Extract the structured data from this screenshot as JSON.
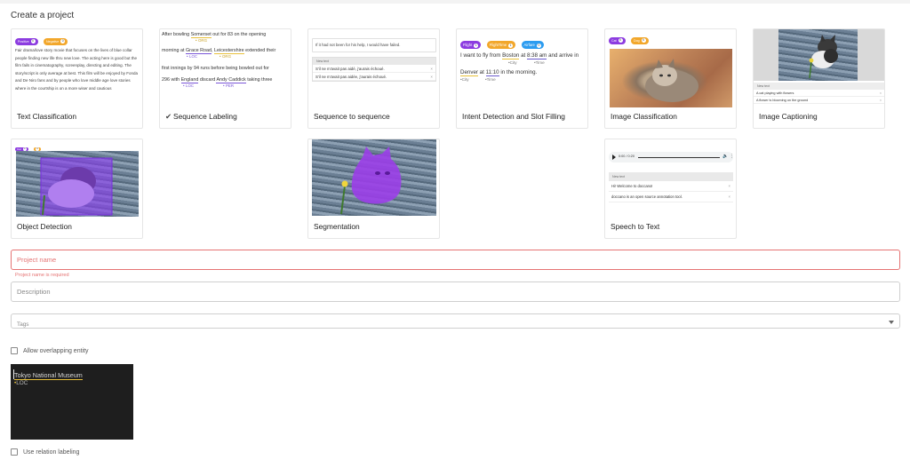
{
  "page": {
    "heading": "Create a project"
  },
  "cards": {
    "text_classification": {
      "label": "Text Classification",
      "chips": [
        {
          "text": "Positive",
          "count": "0",
          "color": "purple"
        },
        {
          "text": "Negative",
          "count": "0",
          "color": "orange"
        }
      ],
      "body": "Fair drama/love story movie that focuses on the lives of blue collar people finding new life thru new love. The acting here is good but the film fails in cinematography, screenplay, directing and editing. The story/script is only average at best. This film will be enjoyed by Fonda and De Niro fans and by people who love middle age love stories where in the courtship is on a more wiser and cautious"
    },
    "sequence_labeling": {
      "label": "Sequence Labeling",
      "check": "✔",
      "line1a": "After bowling ",
      "line1b": "Somerset",
      "line1c": " out for 83 on the opening",
      "tag_org1": "ORG",
      "line2a": "morning at ",
      "line2b": "Grace Road",
      "line2c": ", ",
      "line2d": "Leicestershire",
      "line2e": " extended their",
      "tag_loc1": "LOC",
      "tag_org2": "ORG",
      "line3": "first innings by 94 runs before being bowled out for",
      "line4a": "296 with ",
      "line4b": "England",
      "line4c": " discard ",
      "line4d": "Andy Caddick",
      "line4e": " taking three",
      "tag_loc2": "LOC",
      "tag_per": "PER"
    },
    "sequence_to_sequence": {
      "label": "Sequence to sequence",
      "source": "If it had not been for his help, I would have failed.",
      "new_text": "New text",
      "rows": [
        "S'il ne m'avait pas aidé, j'aurais échoué.",
        "S'il ne m'avait pas aidée, j'aurais échoué."
      ]
    },
    "intent_detection": {
      "label": "Intent Detection and Slot Filling",
      "chips": [
        {
          "text": "Flight",
          "count": "1",
          "color": "purple"
        },
        {
          "text": "FlightTime",
          "count": "1",
          "color": "orange"
        },
        {
          "text": "Airfare",
          "count": "0",
          "color": "blue"
        }
      ],
      "l1a": "I want to fly from ",
      "l1b": "Boston",
      "l1c": " at ",
      "l1d": "8:38 am",
      "l1e": " and arrive in",
      "t_city1": "City",
      "t_time1": "Time",
      "l2a": "Denver",
      "l2b": " at ",
      "l2c": "11:10",
      "l2d": " in the morning.",
      "t_city2": "City",
      "t_time2": "Time"
    },
    "image_classification": {
      "label": "Image Classification",
      "chips": [
        {
          "text": "Cat",
          "count": "0",
          "color": "purple"
        },
        {
          "text": "Dog",
          "count": "0",
          "color": "orange"
        }
      ]
    },
    "image_captioning": {
      "label": "Image Captioning",
      "new_text": "New text",
      "rows": [
        "A cat playing with flowers",
        "A flower is blooming on the ground"
      ]
    },
    "object_detection": {
      "label": "Object Detection",
      "chips": [
        {
          "text": "Cat",
          "count": "0",
          "color": "purple"
        },
        {
          "text": "",
          "count": "0",
          "color": "orange"
        }
      ]
    },
    "segmentation": {
      "label": "Segmentation"
    },
    "speech_to_text": {
      "label": "Speech to Text",
      "time": "0:00 / 0:20",
      "new_text": "New text",
      "rows": [
        "Hi! Welcome to doccano!",
        "doccano is an open source annotation tool."
      ]
    }
  },
  "form": {
    "project_name_placeholder": "Project name",
    "project_name_error": "Project name is required",
    "description_placeholder": "Description",
    "tags_placeholder": "Tags",
    "allow_overlapping_label": "Allow overlapping entity",
    "example_text": "Tokyo National Museum",
    "example_tag": "LOC",
    "use_relation_label": "Use relation labeling"
  },
  "colors": {
    "purple": "#8c3ce0",
    "orange": "#f2a72b",
    "blue": "#2c9cf0",
    "error": "#e57373"
  }
}
